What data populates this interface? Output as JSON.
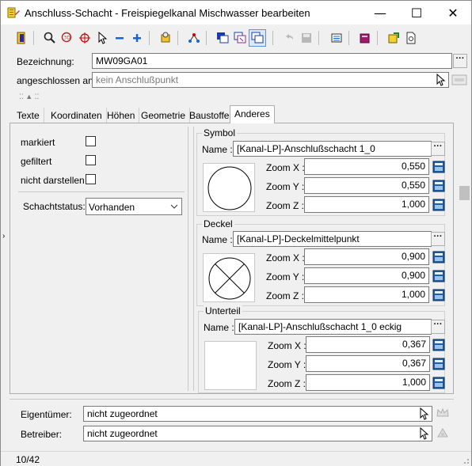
{
  "window": {
    "title": "Anschluss-Schacht - Freispiegelkanal Mischwasser bearbeiten",
    "minimize_glyph": "—",
    "maximize_glyph": "☐",
    "close_glyph": "✕"
  },
  "header": {
    "bezeichnung_label": "Bezeichnung:",
    "bezeichnung_value": "MW09GA01",
    "angeschlossen_label": "angeschlossen an:",
    "angeschlossen_value": "kein Anschlußpunkt",
    "browse_glyph": "···"
  },
  "tabs": [
    "Texte",
    "Koordinaten",
    "Höhen",
    "Geometrie",
    "Baustoffe",
    "Anderes"
  ],
  "left": {
    "markiert": "markiert",
    "gefiltert": "gefiltert",
    "nicht_darstellen": "nicht darstellen",
    "status_label": "Schachtstatus:",
    "status_value": "Vorhanden"
  },
  "symbol": {
    "title": "Symbol",
    "name_label": "Name :",
    "name_value": "[Kanal-LP]-Anschlußschacht 1_0",
    "zoom_x_label": "Zoom X :",
    "zoom_x": "0,550",
    "zoom_y_label": "Zoom Y :",
    "zoom_y": "0,550",
    "zoom_z_label": "Zoom Z :",
    "zoom_z": "1,000"
  },
  "deckel": {
    "title": "Deckel",
    "name_label": "Name :",
    "name_value": "[Kanal-LP]-Deckelmittelpunkt",
    "zoom_x_label": "Zoom X :",
    "zoom_x": "0,900",
    "zoom_y_label": "Zoom Y :",
    "zoom_y": "0,900",
    "zoom_z_label": "Zoom Z :",
    "zoom_z": "1,000"
  },
  "unterteil": {
    "title": "Unterteil",
    "name_label": "Name :",
    "name_value": "[Kanal-LP]-Anschlußschacht 1_0 eckig",
    "zoom_x_label": "Zoom X :",
    "zoom_x": "0,367",
    "zoom_y_label": "Zoom Y :",
    "zoom_y": "0,367",
    "zoom_z_label": "Zoom Z :",
    "zoom_z": "1,000"
  },
  "footer": {
    "eigentuemer_label": "Eigentümer:",
    "eigentuemer_value": "nicht zugeordnet",
    "betreiber_label": "Betreiber:",
    "betreiber_value": "nicht zugeordnet"
  },
  "status": {
    "record": "10/42"
  },
  "colors": {
    "accent": "#0078d7",
    "tab_active_bg": "#ffffff",
    "panel_bg": "#f0f0f0"
  }
}
